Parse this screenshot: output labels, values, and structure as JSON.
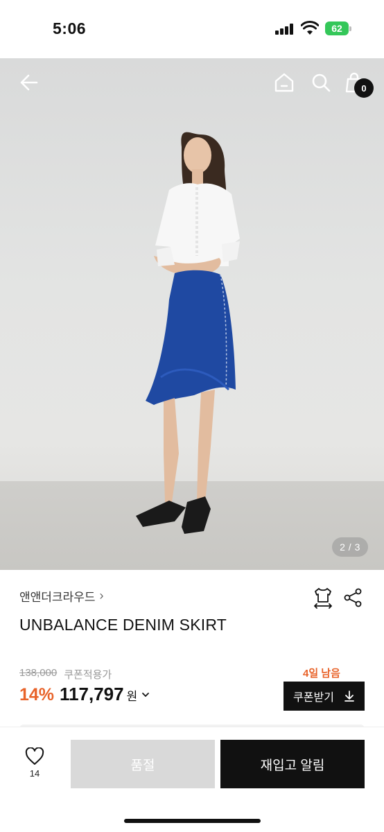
{
  "status_bar": {
    "time": "5:06",
    "battery_level": "62",
    "icons": [
      "signal-icon",
      "wifi-icon",
      "battery-icon"
    ]
  },
  "header": {
    "icons": [
      "back-arrow-icon",
      "home-icon",
      "search-icon",
      "cart-icon"
    ],
    "cart_count": "0"
  },
  "gallery": {
    "indicator": "2 / 3"
  },
  "product": {
    "brand": "앤앤더크라우드",
    "brand_chevron": "›",
    "title": "UNBALANCE DENIM SKIRT",
    "original_price": "138,000",
    "coupon_applied_label": "쿠폰적용가",
    "days_left": "4일 남음",
    "discount": "14%",
    "price": "117,797",
    "currency": "원",
    "coupon_button": "쿠폰받기",
    "icons": [
      "size-guide-icon",
      "share-icon",
      "download-icon",
      "chevron-down-icon"
    ]
  },
  "bottom_bar": {
    "like_count": "14",
    "soldout_label": "품절",
    "restock_label": "재입고 알림",
    "icons": [
      "heart-icon"
    ]
  },
  "colors": {
    "accent": "#e8632a",
    "primary": "#111111",
    "disabled": "#d9d9d9",
    "battery": "#34c759"
  }
}
